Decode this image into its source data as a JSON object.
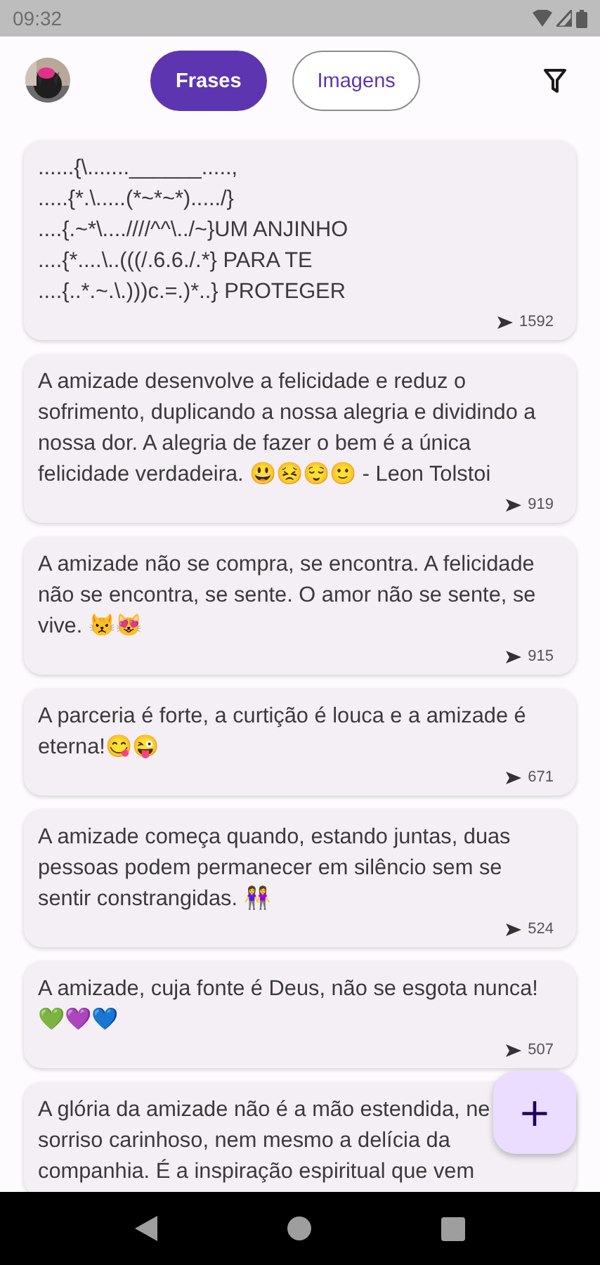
{
  "status_bar": {
    "time": "09:32"
  },
  "tabs": [
    {
      "label": "Frases",
      "selected": true
    },
    {
      "label": "Imagens",
      "selected": false
    }
  ],
  "quotes": [
    {
      "text": "......{\\.......______.....,\n.....{*.\\.....(*~*~*)...../}\n....{.~*\\....////^^\\../~}UM ANJINHO\n....{*....\\..(((/.6.6./.*} PARA TE\n....{..*.~.\\.)))c.=.)*..} PROTEGER",
      "count": "1592"
    },
    {
      "text": "A amizade desenvolve a felicidade e reduz o sofrimento, duplicando a nossa alegria e dividindo a nossa dor. A alegria de fazer o bem é a única felicidade verdadeira. 😃😣😌🙂 - Leon Tolstoi",
      "count": "919"
    },
    {
      "text": "A amizade não se compra, se encontra. A felicidade não se encontra, se sente. O amor não se sente, se vive. 😾😻",
      "count": "915"
    },
    {
      "text": "A parceria é forte, a curtição é louca e a amizade é eterna!😋😜",
      "count": "671"
    },
    {
      "text": "A amizade começa quando, estando juntas, duas pessoas podem permanecer em silêncio sem se sentir constrangidas.  👭",
      "count": "524"
    },
    {
      "text": "A amizade, cuja fonte é Deus, não se esgota nunca! 💚💜💙",
      "count": "507"
    },
    {
      "text": "A glória da amizade não é a mão estendida, ne\nsorriso carinhoso, nem mesmo a delícia da\ncompanhia. É a inspiração espiritual que vem"
    }
  ],
  "fab": {
    "label": "+"
  }
}
